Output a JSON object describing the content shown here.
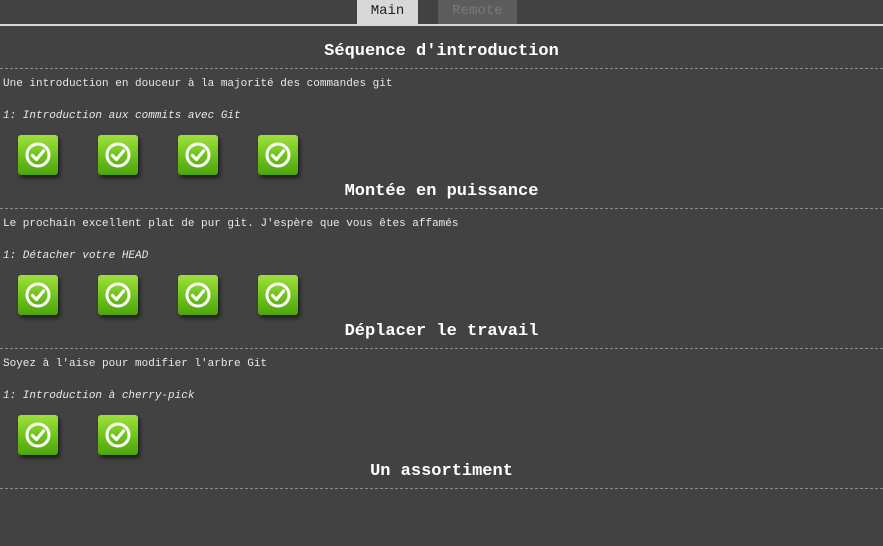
{
  "tabs": {
    "main": "Main",
    "remote": "Remote"
  },
  "sections": [
    {
      "title": "Séquence d'introduction",
      "description": "Une introduction en douceur à la majorité des commandes git",
      "current_level": "1: Introduction aux commits avec Git",
      "levels_completed": 4
    },
    {
      "title": "Montée en puissance",
      "description": "Le prochain excellent plat de pur git. J'espère que vous êtes affamés",
      "current_level": "1: Détacher votre HEAD",
      "levels_completed": 4
    },
    {
      "title": "Déplacer le travail",
      "description": "Soyez à l'aise pour modifier l'arbre Git",
      "current_level": "1: Introduction à cherry-pick",
      "levels_completed": 2
    },
    {
      "title": "Un assortiment"
    }
  ],
  "icons": {
    "level": "check-circle-icon"
  },
  "colors": {
    "background": "#424242",
    "level_complete": "#6cc21a"
  }
}
